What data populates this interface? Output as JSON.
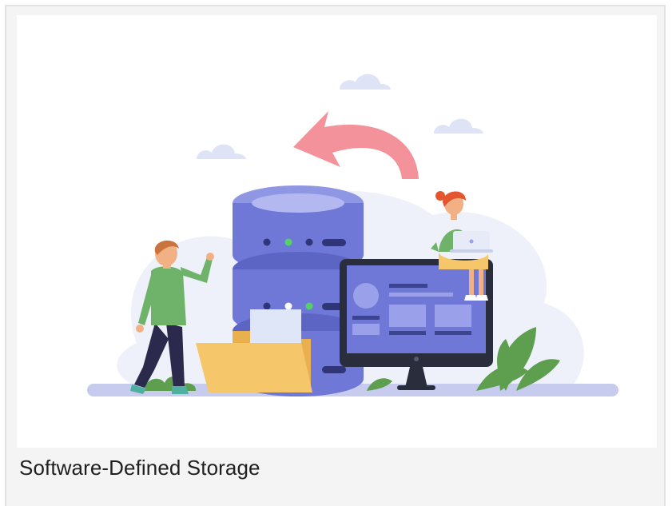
{
  "card": {
    "caption": "Software-Defined Storage",
    "illustration": "storage-illustration",
    "colors": {
      "card_background": "#f4f4f4",
      "server": "#6f78d6",
      "arrow": "#f3929a",
      "folder": "#f6c66b",
      "shirt": "#6fb36a",
      "plant": "#5e9e4f"
    }
  }
}
